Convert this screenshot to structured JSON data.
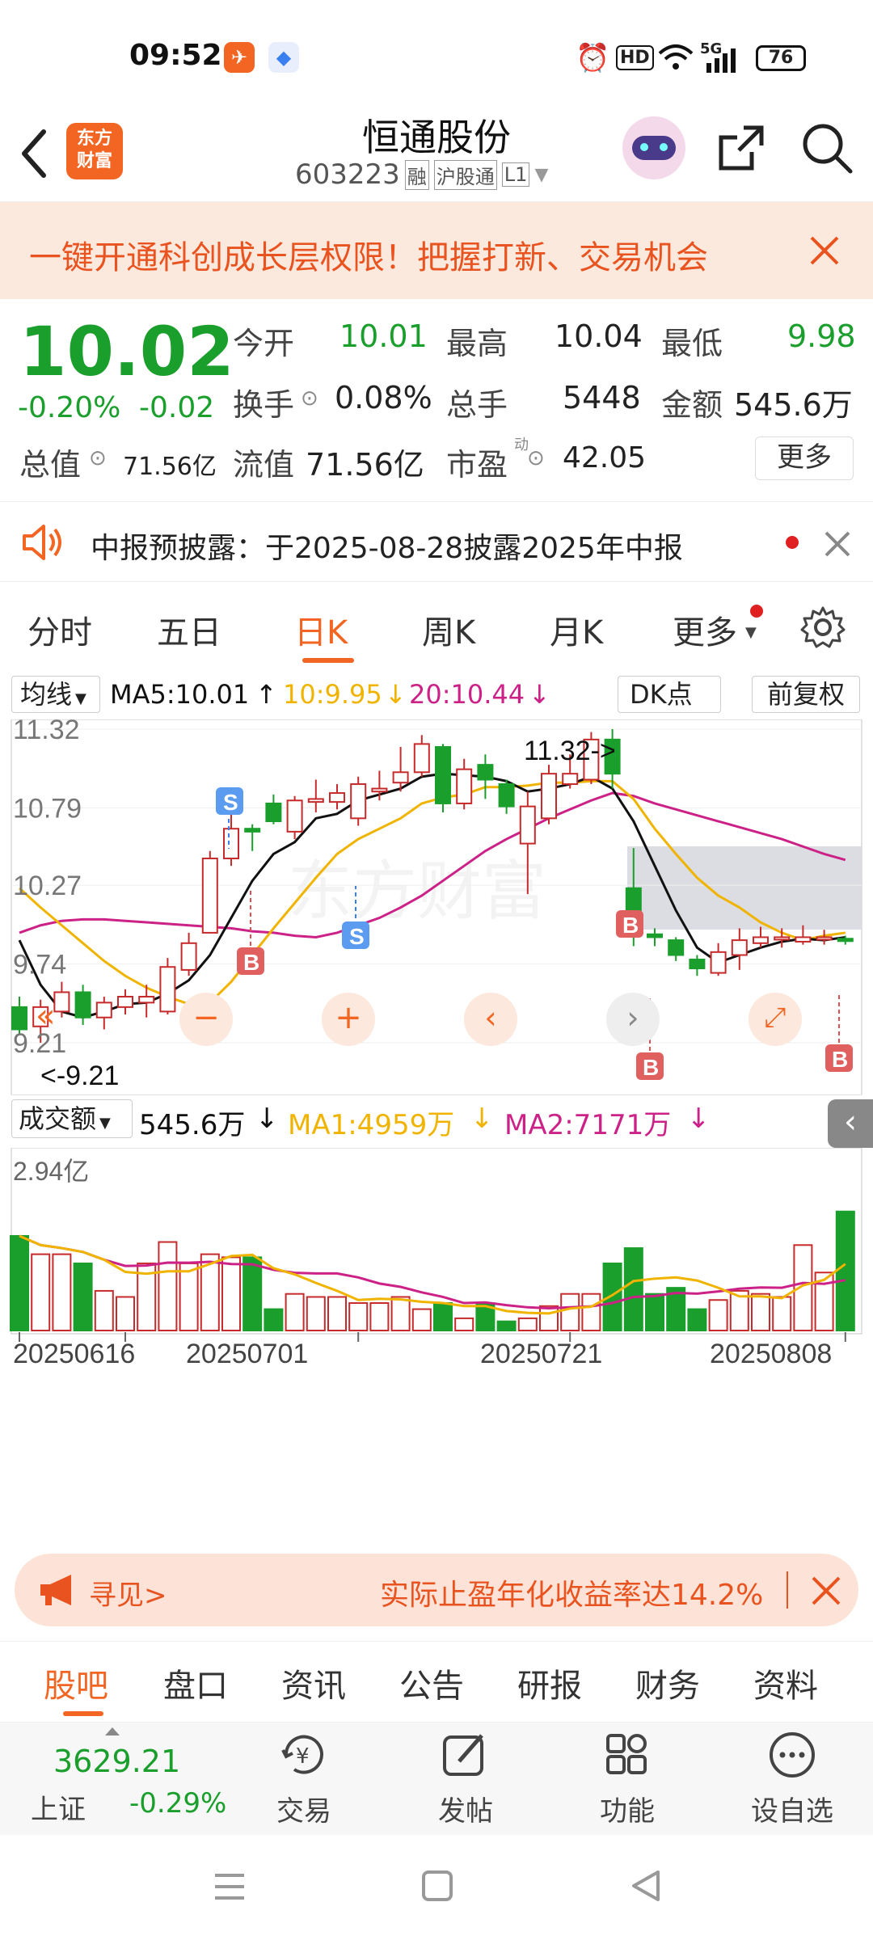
{
  "status_bar": {
    "time": "09:52",
    "network": "5G",
    "hd": "HD",
    "battery": "76"
  },
  "header": {
    "app_logo_text_1": "东方",
    "app_logo_text_2": "财富",
    "stock_name": "恒通股份",
    "stock_code": "603223",
    "tag_margin": "融",
    "tag_connect": "沪股通",
    "tag_level": "L1"
  },
  "banner": {
    "text": "一键开通科创成长层权限！把握打新、交易机会"
  },
  "quote": {
    "price": "10.02",
    "change_pct": "-0.20%",
    "change": "-0.02",
    "open_label": "今开",
    "open": "10.01",
    "high_label": "最高",
    "high": "10.04",
    "low_label": "最低",
    "low": "9.98",
    "turnover_label": "换手",
    "turnover": "0.08%",
    "volume_label": "总手",
    "volume": "5448",
    "amount_label": "金额",
    "amount": "545.6万",
    "total_value_label": "总值",
    "total_value": "71.56亿",
    "float_value_label": "流值",
    "float_value": "71.56亿",
    "pe_label": "市盈",
    "pe_sup": "动",
    "pe": "42.05",
    "more_label": "更多"
  },
  "notice": {
    "text": "中报预披露：于2025-08-28披露2025年中报"
  },
  "k_tabs": [
    "分时",
    "五日",
    "日K",
    "周K",
    "月K",
    "更多"
  ],
  "chart_header": {
    "ma_select": "均线",
    "ma5": "MA5:10.01",
    "ma10": "10:9.95",
    "ma20": "20:10.44",
    "dk": "DK点",
    "adjust": "前复权"
  },
  "chart_labels": {
    "y_ticks": [
      "11.32",
      "10.79",
      "10.27",
      "9.74",
      "9.21"
    ],
    "max_note": "11.32->",
    "min_note": "<-9.21",
    "signal_s": "S",
    "signal_b": "B",
    "watermark": "东方财富"
  },
  "volume_header": {
    "select": "成交额",
    "value": "545.6万",
    "ma1": "MA1:4959万",
    "ma2": "MA2:7171万",
    "y_top": "2.94亿"
  },
  "x_dates": [
    "20250616",
    "20250701",
    "20250721",
    "20250808"
  ],
  "ad": {
    "left": "寻见>",
    "text": "实际止盈年化收益率达14.2%"
  },
  "bottom_tabs": [
    "股吧",
    "盘口",
    "资讯",
    "公告",
    "研报",
    "财务",
    "资料"
  ],
  "toolbar": {
    "index_value": "3629.21",
    "index_name": "上证",
    "index_change": "-0.29%",
    "trade": "交易",
    "post": "发帖",
    "func": "功能",
    "watchlist": "设自选"
  },
  "colors": {
    "up": "#e02020",
    "down": "#1a9e2c",
    "accent": "#f26522",
    "ma5": "#111111",
    "ma10": "#f0b400",
    "ma20": "#cc2288"
  },
  "chart_data": {
    "type": "candlestick",
    "candles": [
      {
        "o": 9.45,
        "c": 9.3,
        "h": 9.52,
        "l": 9.26
      },
      {
        "o": 9.32,
        "c": 9.45,
        "h": 9.5,
        "l": 9.21
      },
      {
        "o": 9.42,
        "c": 9.55,
        "h": 9.62,
        "l": 9.38
      },
      {
        "o": 9.55,
        "c": 9.38,
        "h": 9.6,
        "l": 9.33
      },
      {
        "o": 9.38,
        "c": 9.48,
        "h": 9.52,
        "l": 9.3
      },
      {
        "o": 9.45,
        "c": 9.52,
        "h": 9.57,
        "l": 9.4
      },
      {
        "o": 9.48,
        "c": 9.52,
        "h": 9.6,
        "l": 9.38
      },
      {
        "o": 9.42,
        "c": 9.72,
        "h": 9.78,
        "l": 9.4
      },
      {
        "o": 9.7,
        "c": 9.88,
        "h": 9.95,
        "l": 9.66
      },
      {
        "o": 9.95,
        "c": 10.45,
        "h": 10.5,
        "l": 9.95
      },
      {
        "o": 10.45,
        "c": 10.65,
        "h": 10.82,
        "l": 10.4
      },
      {
        "o": 10.65,
        "c": 10.63,
        "h": 10.68,
        "l": 10.5
      },
      {
        "o": 10.82,
        "c": 10.7,
        "h": 10.88,
        "l": 10.68
      },
      {
        "o": 10.63,
        "c": 10.84,
        "h": 10.87,
        "l": 10.58
      },
      {
        "o": 10.83,
        "c": 10.85,
        "h": 10.98,
        "l": 10.76
      },
      {
        "o": 10.83,
        "c": 10.89,
        "h": 10.95,
        "l": 10.78
      },
      {
        "o": 10.72,
        "c": 10.95,
        "h": 11.0,
        "l": 10.67
      },
      {
        "o": 10.9,
        "c": 10.92,
        "h": 11.04,
        "l": 10.84
      },
      {
        "o": 10.96,
        "c": 11.03,
        "h": 11.2,
        "l": 10.9
      },
      {
        "o": 11.03,
        "c": 11.22,
        "h": 11.28,
        "l": 11.0
      },
      {
        "o": 11.2,
        "c": 10.82,
        "h": 11.22,
        "l": 10.76
      },
      {
        "o": 10.82,
        "c": 11.05,
        "h": 11.12,
        "l": 10.78
      },
      {
        "o": 11.08,
        "c": 10.98,
        "h": 11.15,
        "l": 10.85
      },
      {
        "o": 10.95,
        "c": 10.8,
        "h": 10.98,
        "l": 10.75
      },
      {
        "o": 10.55,
        "c": 10.8,
        "h": 10.9,
        "l": 10.21
      },
      {
        "o": 10.72,
        "c": 11.02,
        "h": 11.08,
        "l": 10.68
      },
      {
        "o": 10.95,
        "c": 11.02,
        "h": 11.15,
        "l": 10.92
      },
      {
        "o": 10.98,
        "c": 11.25,
        "h": 11.3,
        "l": 10.95
      },
      {
        "o": 11.25,
        "c": 11.02,
        "h": 11.32,
        "l": 10.92
      },
      {
        "o": 10.25,
        "c": 9.95,
        "h": 10.52,
        "l": 9.86
      },
      {
        "o": 9.94,
        "c": 9.92,
        "h": 9.98,
        "l": 9.86
      },
      {
        "o": 9.9,
        "c": 9.8,
        "h": 9.92,
        "l": 9.76
      },
      {
        "o": 9.77,
        "c": 9.71,
        "h": 9.8,
        "l": 9.66
      },
      {
        "o": 9.68,
        "c": 9.82,
        "h": 9.88,
        "l": 9.66
      },
      {
        "o": 9.8,
        "c": 9.9,
        "h": 9.98,
        "l": 9.7
      },
      {
        "o": 9.88,
        "c": 9.92,
        "h": 9.99,
        "l": 9.85
      },
      {
        "o": 9.91,
        "c": 9.92,
        "h": 9.98,
        "l": 9.85
      },
      {
        "o": 9.89,
        "c": 9.92,
        "h": 10.0,
        "l": 9.87
      },
      {
        "o": 9.91,
        "c": 9.92,
        "h": 9.97,
        "l": 9.87
      },
      {
        "o": 9.91,
        "c": 9.9,
        "h": 9.93,
        "l": 9.87
      }
    ],
    "ma5": [
      9.9,
      9.6,
      9.42,
      9.38,
      9.42,
      9.47,
      9.48,
      9.54,
      9.63,
      9.8,
      10.05,
      10.3,
      10.48,
      10.56,
      10.72,
      10.75,
      10.84,
      10.88,
      10.92,
      11.0,
      11.02,
      11.01,
      11.0,
      10.97,
      10.9,
      10.92,
      10.95,
      11.0,
      10.92,
      10.7,
      10.4,
      10.1,
      9.85,
      9.75,
      9.8,
      9.85,
      9.89,
      9.91,
      9.9,
      9.92
    ],
    "ma10": [
      10.25,
      10.12,
      10.0,
      9.88,
      9.76,
      9.66,
      9.58,
      9.52,
      9.47,
      9.48,
      9.62,
      9.8,
      9.98,
      10.15,
      10.32,
      10.48,
      10.58,
      10.65,
      10.72,
      10.82,
      10.86,
      10.88,
      10.93,
      10.93,
      10.94,
      10.96,
      10.96,
      10.97,
      10.97,
      10.85,
      10.65,
      10.48,
      10.32,
      10.2,
      10.12,
      10.02,
      9.95,
      9.9,
      9.93,
      9.95
    ],
    "ma20": [
      9.95,
      10.0,
      10.03,
      10.04,
      10.04,
      10.03,
      10.02,
      10.01,
      10.0,
      9.99,
      9.98,
      9.96,
      9.95,
      9.93,
      9.92,
      9.95,
      10.0,
      10.05,
      10.12,
      10.2,
      10.3,
      10.4,
      10.5,
      10.58,
      10.65,
      10.72,
      10.78,
      10.84,
      10.89,
      10.87,
      10.82,
      10.78,
      10.74,
      10.7,
      10.66,
      10.62,
      10.58,
      10.53,
      10.48,
      10.44
    ],
    "y_range": [
      9.21,
      11.32
    ],
    "volumes": [
      1.55,
      1.25,
      1.25,
      1.1,
      0.65,
      0.55,
      1.1,
      1.45,
      1.1,
      1.25,
      1.2,
      1.2,
      0.35,
      0.6,
      0.55,
      0.55,
      0.45,
      0.45,
      0.55,
      0.35,
      0.45,
      0.2,
      0.45,
      0.15,
      0.2,
      0.4,
      0.6,
      0.6,
      1.1,
      1.35,
      0.6,
      0.7,
      0.35,
      0.5,
      0.65,
      0.6,
      0.55,
      1.4,
      0.95,
      1.95
    ],
    "volume_ylim": [
      0,
      2.94
    ]
  }
}
